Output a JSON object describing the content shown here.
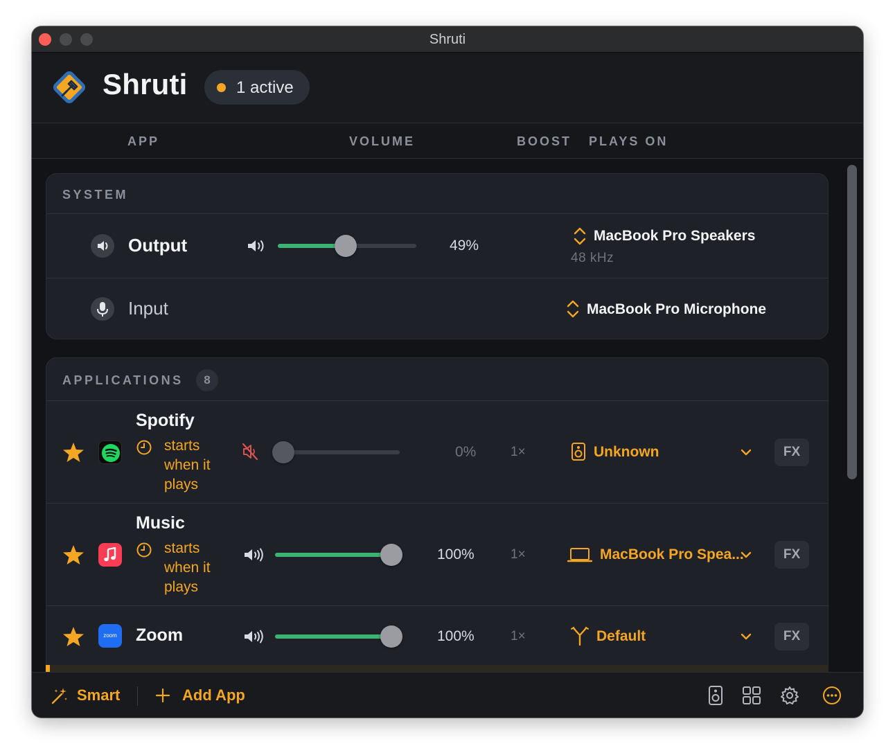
{
  "window": {
    "title": "Shruti"
  },
  "header": {
    "app_title": "Shruti",
    "active_badge": "1 active"
  },
  "columns": {
    "app": "APP",
    "volume": "VOLUME",
    "boost": "BOOST",
    "plays_on": "PLAYS ON"
  },
  "system": {
    "label": "SYSTEM",
    "output": {
      "label": "Output",
      "volume_percent": 49,
      "volume_text": "49%",
      "device": "MacBook Pro Speakers",
      "sample_rate": "48  kHz"
    },
    "input": {
      "label": "Input",
      "device": "MacBook Pro Microphone"
    }
  },
  "applications": {
    "label": "APPLICATIONS",
    "count": "8",
    "items": [
      {
        "name": "Spotify",
        "starts_text": "starts when it plays",
        "muted": true,
        "volume_percent": 0,
        "volume_text": "0%",
        "boost": "1×",
        "device": "Unknown",
        "fx": "FX"
      },
      {
        "name": "Music",
        "starts_text": "starts when it plays",
        "muted": false,
        "volume_percent": 100,
        "volume_text": "100%",
        "boost": "1×",
        "device": "MacBook Pro Spea...",
        "fx": "FX"
      },
      {
        "name": "Zoom",
        "muted": false,
        "volume_percent": 100,
        "volume_text": "100%",
        "boost": "1×",
        "device": "Default",
        "fx": "FX",
        "icon_text": "zoom"
      }
    ]
  },
  "footer": {
    "smart": "Smart",
    "add_app": "Add App"
  },
  "colors": {
    "accent": "#f5a623",
    "slider": "#3cb371",
    "background": "#15171b",
    "card": "#1e2128"
  }
}
